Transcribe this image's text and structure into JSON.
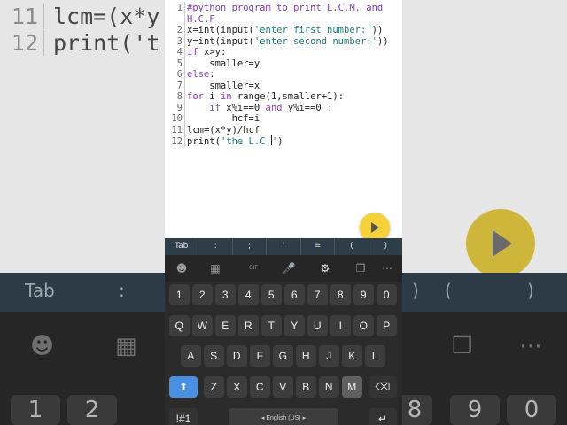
{
  "editor": {
    "lines": [
      {
        "num": "1",
        "parts": [
          {
            "t": "#python program to print L.C.M. and",
            "c": "cm"
          }
        ]
      },
      {
        "num": "",
        "parts": [
          {
            "t": "H.C.F",
            "c": "cm"
          }
        ]
      },
      {
        "num": "2",
        "parts": [
          {
            "t": "x=int(input(",
            "c": ""
          },
          {
            "t": "'enter first number:'",
            "c": "st"
          },
          {
            "t": "))",
            "c": ""
          }
        ]
      },
      {
        "num": "3",
        "parts": [
          {
            "t": "y=int(input(",
            "c": ""
          },
          {
            "t": "'enter second number:'",
            "c": "st"
          },
          {
            "t": "))",
            "c": ""
          }
        ]
      },
      {
        "num": "4",
        "parts": [
          {
            "t": "if",
            "c": "kw"
          },
          {
            "t": " x>y:",
            "c": ""
          }
        ]
      },
      {
        "num": "5",
        "parts": [
          {
            "t": "    smaller=y",
            "c": ""
          }
        ]
      },
      {
        "num": "6",
        "parts": [
          {
            "t": "else",
            "c": "kw"
          },
          {
            "t": ":",
            "c": ""
          }
        ]
      },
      {
        "num": "7",
        "parts": [
          {
            "t": "    smaller=x",
            "c": ""
          }
        ]
      },
      {
        "num": "8",
        "parts": [
          {
            "t": "for",
            "c": "kw"
          },
          {
            "t": " i ",
            "c": ""
          },
          {
            "t": "in",
            "c": "kw"
          },
          {
            "t": " range(1,smaller+1):",
            "c": ""
          }
        ]
      },
      {
        "num": "9",
        "parts": [
          {
            "t": "    ",
            "c": ""
          },
          {
            "t": "if",
            "c": "kw"
          },
          {
            "t": " x%i==0 ",
            "c": ""
          },
          {
            "t": "and",
            "c": "kw"
          },
          {
            "t": " y%i==0 :",
            "c": ""
          }
        ]
      },
      {
        "num": "10",
        "parts": [
          {
            "t": "        hcf=i",
            "c": ""
          }
        ]
      },
      {
        "num": "11",
        "parts": [
          {
            "t": "lcm=(x*y)/hcf",
            "c": ""
          }
        ]
      },
      {
        "num": "12",
        "parts": [
          {
            "t": "print(",
            "c": ""
          },
          {
            "t": "'the L.C.",
            "c": "st"
          },
          {
            "t": "CURSOR",
            "c": "cursor"
          },
          {
            "t": "'",
            "c": "st"
          },
          {
            "t": ")",
            "c": ""
          }
        ]
      }
    ]
  },
  "background": {
    "editor_lines": [
      {
        "num": "11",
        "text": "lcm=(x*y"
      },
      {
        "num": "12",
        "text": "print('t"
      }
    ],
    "symbols": [
      "Tab",
      ":",
      ")",
      "(",
      ")"
    ],
    "number_keys": [
      "1",
      "2",
      "8",
      "9",
      "0"
    ]
  },
  "run_button": {
    "icon": "play-icon"
  },
  "symbol_bar": [
    "Tab",
    ":",
    ";",
    "'",
    "=",
    "(",
    ")"
  ],
  "keyboard": {
    "toolbar": [
      {
        "icon": "emoji-icon",
        "glyph": "☻"
      },
      {
        "icon": "sticker-icon",
        "glyph": "▦"
      },
      {
        "icon": "gif-icon",
        "glyph": "GIF"
      },
      {
        "icon": "microphone-icon",
        "glyph": "🎤"
      },
      {
        "icon": "settings-gear-icon",
        "glyph": "⚙"
      },
      {
        "icon": "clipboard-icon",
        "glyph": "❐"
      },
      {
        "icon": "more-options-icon",
        "glyph": "⋯"
      }
    ],
    "row_numbers": [
      "1",
      "2",
      "3",
      "4",
      "5",
      "6",
      "7",
      "8",
      "9",
      "0"
    ],
    "row_qwerty": [
      "Q",
      "W",
      "E",
      "R",
      "T",
      "Y",
      "U",
      "I",
      "O",
      "P"
    ],
    "row_asdf": [
      "A",
      "S",
      "D",
      "F",
      "G",
      "H",
      "J",
      "K",
      "L"
    ],
    "row_zxcv": [
      "Z",
      "X",
      "C",
      "V",
      "B",
      "N",
      "M"
    ],
    "pressed_key": "M",
    "shift_glyph": "⬆",
    "backspace_glyph": "⌫",
    "symbols_key": "!#1",
    "space_label": "◂ English (US) ▸",
    "enter_glyph": "↵"
  },
  "colors": {
    "symbar": "#2d3e48",
    "run_button": "#f6d23a",
    "shift_active": "#4a90e2",
    "comment": "#7a3fb0",
    "string": "#1e7f7a"
  }
}
